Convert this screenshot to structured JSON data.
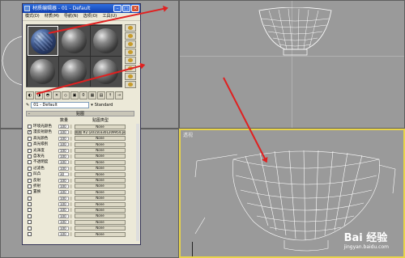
{
  "editor": {
    "title": "材质编辑器 - 01 - Default",
    "menu": [
      "模式(D)",
      "材质(M)",
      "导航(N)",
      "选项(O)",
      "工具(U)"
    ],
    "material_name": "01 - Default",
    "material_type": "Standard",
    "rollout_title": "贴图",
    "col_amount": "数量",
    "col_maptype": "贴图类型",
    "maps": [
      {
        "name": "环境光颜色",
        "amount": "100",
        "map": "None",
        "checked": false
      },
      {
        "name": "漫反射颜色",
        "amount": "100",
        "map": "贴图 #2 (201503301209954.png)",
        "checked": true
      },
      {
        "name": "高光颜色",
        "amount": "100",
        "map": "None",
        "checked": false
      },
      {
        "name": "高光级别",
        "amount": "100",
        "map": "None",
        "checked": false
      },
      {
        "name": "光泽度",
        "amount": "100",
        "map": "None",
        "checked": false
      },
      {
        "name": "自发光",
        "amount": "100",
        "map": "None",
        "checked": false
      },
      {
        "name": "不透明度",
        "amount": "100",
        "map": "None",
        "checked": false
      },
      {
        "name": "过滤色",
        "amount": "100",
        "map": "None",
        "checked": false
      },
      {
        "name": "凹凸",
        "amount": "30",
        "map": "None",
        "checked": false
      },
      {
        "name": "反射",
        "amount": "100",
        "map": "None",
        "checked": false
      },
      {
        "name": "折射",
        "amount": "100",
        "map": "None",
        "checked": false
      },
      {
        "name": "置换",
        "amount": "100",
        "map": "None",
        "checked": false
      },
      {
        "name": "",
        "amount": "100",
        "map": "None",
        "checked": false
      },
      {
        "name": "",
        "amount": "100",
        "map": "None",
        "checked": false
      },
      {
        "name": "",
        "amount": "100",
        "map": "None",
        "checked": false
      },
      {
        "name": "",
        "amount": "100",
        "map": "None",
        "checked": false
      },
      {
        "name": "",
        "amount": "100",
        "map": "None",
        "checked": false
      },
      {
        "name": "",
        "amount": "100",
        "map": "None",
        "checked": false
      },
      {
        "name": "",
        "amount": "100",
        "map": "None",
        "checked": false
      }
    ]
  },
  "viewport": {
    "label": "透视"
  },
  "watermark": {
    "brand": "Bai 经验",
    "url": "jingyan.baidu.com"
  },
  "colors": {
    "highlight": "#e8d44a",
    "arrow": "#e02020"
  }
}
